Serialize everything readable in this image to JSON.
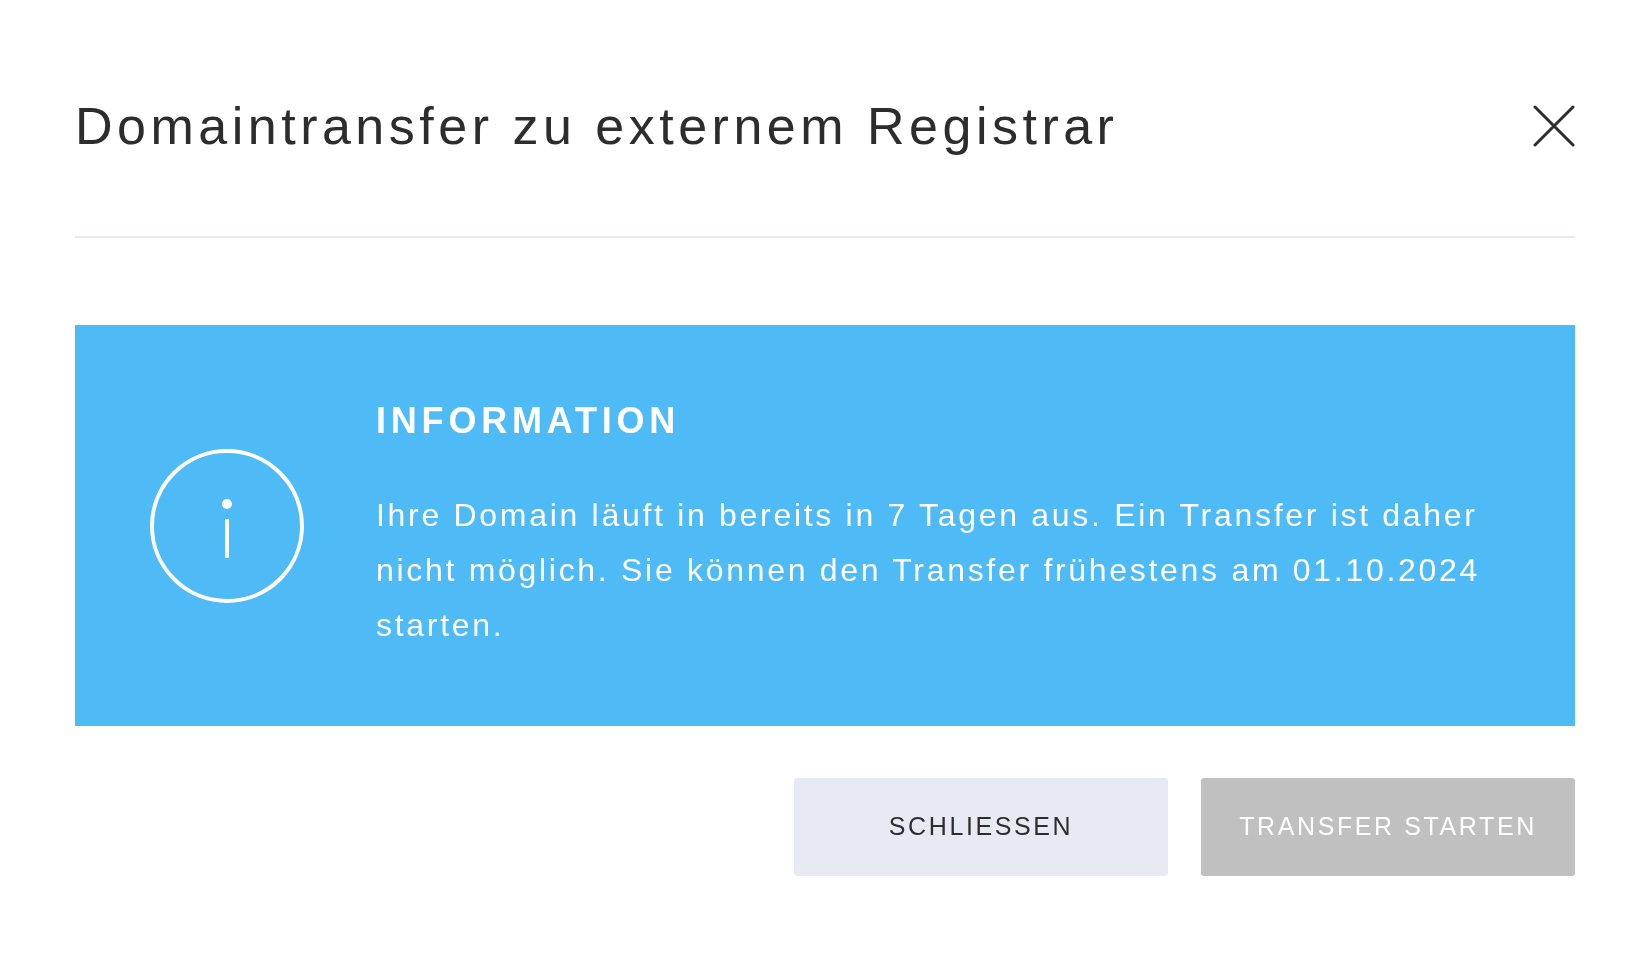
{
  "dialog": {
    "title": "Domaintransfer zu externem Registrar"
  },
  "alert": {
    "kind": "info",
    "heading": "INFORMATION",
    "message": "Ihre Domain läuft in bereits in 7 Tagen aus. Ein Transfer ist daher nicht möglich. Sie können den Transfer frühestens am 01.10.2024 starten."
  },
  "buttons": [
    {
      "label": "SCHLIESSEN",
      "kind": "secondary",
      "disabled": false
    },
    {
      "label": "TRANSFER STARTEN",
      "kind": "primary",
      "disabled": true
    }
  ]
}
